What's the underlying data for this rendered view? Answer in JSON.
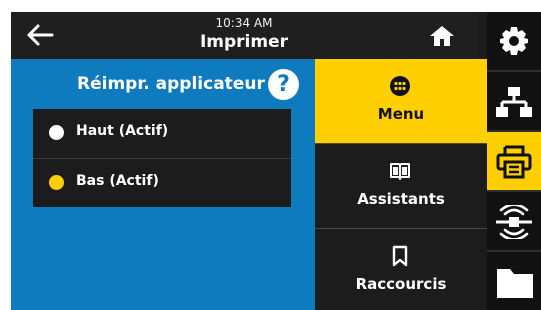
{
  "header": {
    "time": "10:34 AM",
    "title": "Imprimer"
  },
  "panel": {
    "title": "Réimpr. applicateur",
    "help_symbol": "?",
    "options": [
      {
        "label": "Haut (Actif)",
        "selected": false
      },
      {
        "label": "Bas (Actif)",
        "selected": true
      }
    ]
  },
  "menu": {
    "items": [
      {
        "label": "Menu",
        "icon": "dots-icon",
        "active": true
      },
      {
        "label": "Assistants",
        "icon": "book-icon",
        "active": false
      },
      {
        "label": "Raccourcis",
        "icon": "bookmark-icon",
        "active": false
      }
    ]
  },
  "rail": {
    "items": [
      {
        "icon": "gear-icon",
        "active": false
      },
      {
        "icon": "network-icon",
        "active": false
      },
      {
        "icon": "printer-icon",
        "active": true
      },
      {
        "icon": "rfid-icon",
        "active": false
      },
      {
        "icon": "folder-icon",
        "active": false
      }
    ]
  },
  "colors": {
    "accent": "#ffcf00",
    "panel": "#0f7bbf",
    "background": "#1c1c1c"
  }
}
